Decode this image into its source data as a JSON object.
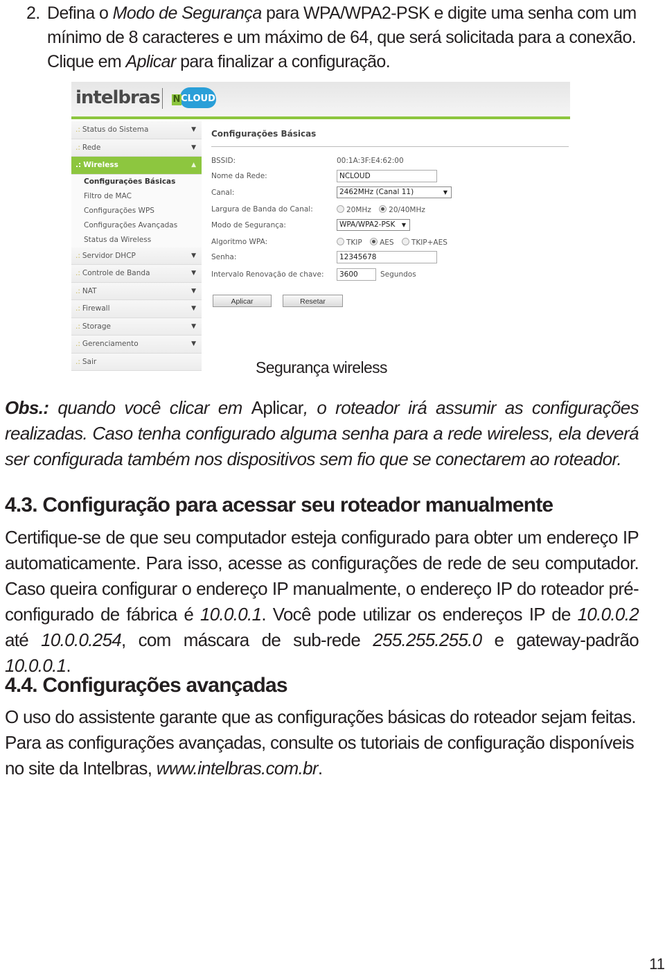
{
  "step2": {
    "number": "2.",
    "text_a": "Defina o ",
    "text_b_italic": "Modo de Segurança",
    "text_c": " para WPA/WPA2-PSK e digite uma senha com um mínimo de 8 caracteres e um máximo de 64, que será solicitada para a conexão. Clique em ",
    "text_d_italic": "Aplicar",
    "text_e": " para finalizar a configuração."
  },
  "screenshot": {
    "brand": "intelbras",
    "product_n": "N",
    "product_cloud": "CLOUD",
    "brand_color": "#8dc63f",
    "cloud_color": "#2a9fd8",
    "sidebar": {
      "prefix": ".:",
      "items": [
        {
          "label": "Status do Sistema",
          "arrow": "▼"
        },
        {
          "label": "Rede",
          "arrow": "▼"
        },
        {
          "label": "Wireless",
          "arrow": "▲",
          "active": true
        },
        {
          "label": "Servidor DHCP",
          "arrow": "▼"
        },
        {
          "label": "Controle de Banda",
          "arrow": "▼"
        },
        {
          "label": "NAT",
          "arrow": "▼"
        },
        {
          "label": "Firewall",
          "arrow": "▼"
        },
        {
          "label": "Storage",
          "arrow": "▼"
        },
        {
          "label": "Gerenciamento",
          "arrow": "▼"
        },
        {
          "label": "Sair",
          "arrow": ""
        }
      ],
      "wireless_subitems": [
        {
          "label": "Configurações Básicas",
          "current": true
        },
        {
          "label": "Filtro de MAC"
        },
        {
          "label": "Configurações WPS"
        },
        {
          "label": "Configurações Avançadas"
        },
        {
          "label": "Status da Wireless"
        }
      ]
    },
    "form": {
      "title": "Configurações Básicas",
      "bssid_label": "BSSID:",
      "bssid_value": "00:1A:3F:E4:62:00",
      "ssid_label": "Nome da Rede:",
      "ssid_value": "NCLOUD",
      "channel_label": "Canal:",
      "channel_value": "2462MHz (Canal 11)",
      "bandwidth_label": "Largura de Banda do Canal:",
      "bandwidth_options": [
        "20MHz",
        "20/40MHz"
      ],
      "bandwidth_selected": "20/40MHz",
      "security_label": "Modo de Segurança:",
      "security_value": "WPA/WPA2-PSK",
      "wpa_label": "Algoritmo WPA:",
      "wpa_options": [
        "TKIP",
        "AES",
        "TKIP+AES"
      ],
      "wpa_selected": "AES",
      "password_label": "Senha:",
      "password_value": "12345678",
      "rekey_label": "Intervalo Renovação de chave:",
      "rekey_value": "3600",
      "rekey_unit": "Segundos",
      "apply_label": "Aplicar",
      "reset_label": "Resetar",
      "caret": "▼"
    }
  },
  "caption": "Segurança wireless",
  "obs": {
    "label": "Obs.:",
    "text_a": " quando você clicar em ",
    "text_b_upright": "Aplicar",
    "text_c": ", o roteador irá assumir as configurações realizadas. Caso tenha configurado alguma senha para a rede wireless, ela deverá ser configurada também nos dispositivos sem fio que se conectarem ao roteador."
  },
  "section43": {
    "heading": "4.3. Configuração para acessar seu roteador manualmente",
    "p_a": "Certifique-se de que seu computador esteja configurado para obter um endereço IP automaticamente. Para isso, acesse as configurações de rede de seu computador. Caso queira configurar o endereço IP manualmente, o endereço IP do roteador pré-configurado de fábrica é ",
    "ip_router": "10.0.0.1",
    "p_b": ". Você pode utilizar os endereços IP de ",
    "ip_start": "10.0.0.2",
    "p_c": " até ",
    "ip_end": "10.0.0.254",
    "p_d": ", com máscara de sub-rede ",
    "mask": "255.255.255.0",
    "p_e": " e gateway-padrão ",
    "gateway": "10.0.0.1",
    "p_f": "."
  },
  "section44": {
    "heading": "4.4. Configurações avançadas",
    "p_a": "O uso do assistente garante que as configurações básicas do roteador sejam feitas. Para as configurações avançadas, consulte os tutoriais de configuração disponíveis no site da Intelbras, ",
    "url": "www.intelbras.com.br",
    "p_b": "."
  },
  "page_number": "11"
}
